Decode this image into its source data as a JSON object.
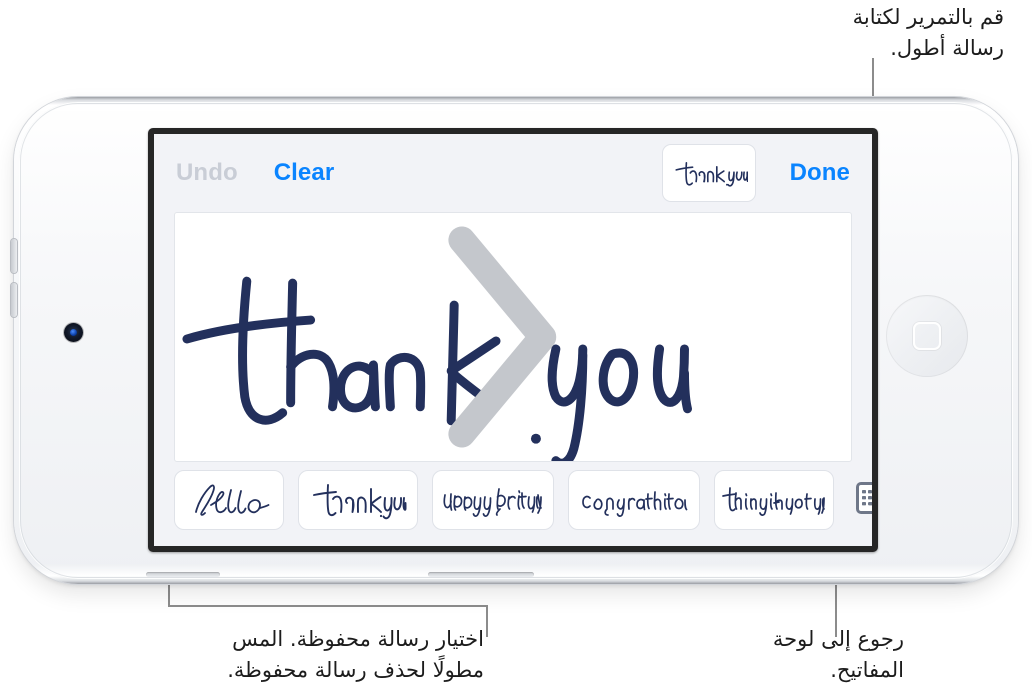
{
  "callouts": {
    "scroll": "قم بالتمرير لكتابة\nرسالة أطول.",
    "saved_messages": "اختيار رسالة محفوظة. المس\nمطولًا لحذف رسالة محفوظة.",
    "keyboard": "رجوع إلى لوحة\nالمفاتيح."
  },
  "device": {
    "name": "ipod-touch",
    "camera": "front-camera",
    "home_button": "home-button",
    "buttons": [
      "volume-up",
      "volume-down"
    ]
  },
  "screen": {
    "toolbar": {
      "undo_label": "Undo",
      "undo_enabled": false,
      "clear_label": "Clear",
      "done_label": "Done",
      "preview_text": "thank you"
    },
    "canvas": {
      "handwriting_text": "thank you",
      "ink_color": "#23305c",
      "background": "#ffffff",
      "next_arrow": "chevron-right"
    },
    "suggestions": [
      {
        "text": "hello"
      },
      {
        "text": "thank you"
      },
      {
        "text": "happy birthday"
      },
      {
        "text": "congratulations"
      },
      {
        "text": "thinking of you"
      }
    ],
    "keyboard_button_icon": "keyboard-icon"
  },
  "colors": {
    "accent_blue": "#0a84ff",
    "disabled_gray": "#c9cdd6",
    "screen_background": "#f2f3f7",
    "ink": "#23305c",
    "leader_line": "#8c8c8c"
  }
}
